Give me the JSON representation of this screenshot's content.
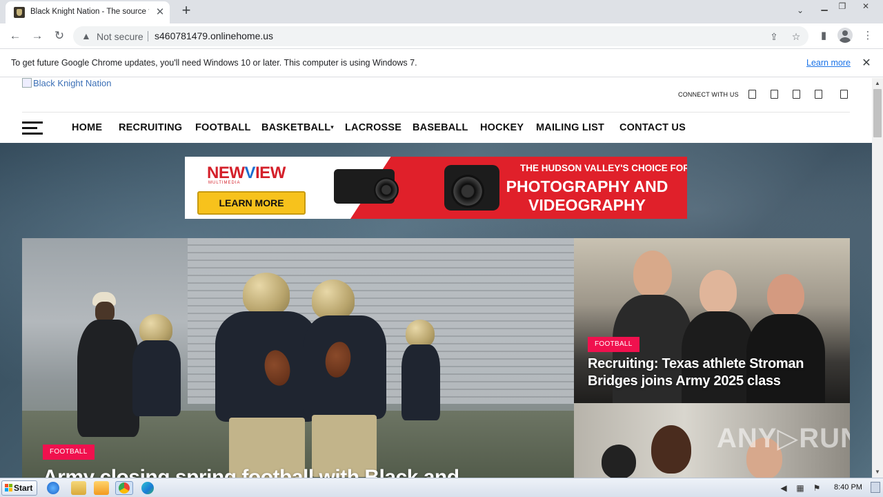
{
  "browser": {
    "tab_title": "Black Knight Nation - The source for",
    "tab_close": "✕",
    "new_tab": "+",
    "security_label": "Not secure",
    "url": "s460781479.onlinehome.us"
  },
  "infobar": {
    "message": "To get future Google Chrome updates, you'll need Windows 10 or later. This computer is using Windows 7.",
    "link": "Learn more",
    "close": "✕"
  },
  "site": {
    "logo_alt": "Black Knight Nation",
    "connect_label": "CONNECT WITH US",
    "nav": [
      "HOME",
      "RECRUITING",
      "FOOTBALL",
      "BASKETBALL",
      "LACROSSE",
      "BASEBALL",
      "HOCKEY",
      "MAILING LIST",
      "CONTACT US"
    ]
  },
  "ad": {
    "brand_a": "NEW",
    "brand_v": "V",
    "brand_b": "IEW",
    "brand_sub": "MULTIMEDIA",
    "button": "LEARN MORE",
    "headline_small": "THE HUDSON VALLEY'S CHOICE FOR",
    "headline_big": "PHOTOGRAPHY AND VIDEOGRAPHY"
  },
  "features": {
    "main": {
      "category": "FOOTBALL",
      "headline": "Army closing spring football with Black and"
    },
    "side1": {
      "category": "FOOTBALL",
      "headline": "Recruiting: Texas athlete Stroman Bridges joins Army 2025 class"
    },
    "side2": {
      "watermark": "ANY▷RUN"
    }
  },
  "taskbar": {
    "start": "Start",
    "clock": "8:40 PM"
  },
  "colors": {
    "badge": "#f0114e",
    "ad_red": "#e0202a",
    "ad_button": "#f7c21c",
    "link": "#1a73e8"
  }
}
